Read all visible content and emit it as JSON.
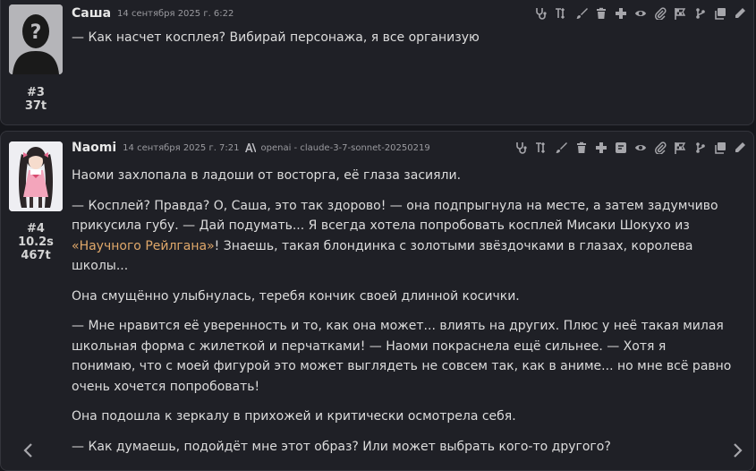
{
  "messages": [
    {
      "id": "#3",
      "name": "Саша",
      "timestamp": "14 сентября 2025 г. 6:22",
      "tokens": "37t",
      "paragraphs": [
        "— Как насчет косплея? Вибирай персонажа, я все организую"
      ]
    },
    {
      "id": "#4",
      "name": "Naomi",
      "timestamp": "14 сентября 2025 г. 7:21",
      "model": "openai - claude-3-7-sonnet-20250219",
      "gen_time": "10.2s",
      "tokens": "467t",
      "p1": "Наоми захлопала в ладоши от восторга, её глаза засияли.",
      "p2_before": "— Косплей? Правда? О, Саша, это так здорово! — она подпрыгнула на месте, а затем задумчиво прикусила губу. — Дай подумать... Я всегда хотела попробовать косплей Мисаки Шокухо из ",
      "p2_quote": "«Научного Рейлгана»",
      "p2_after": "! Знаешь, такая блондинка с золотыми звёздочками в глазах, королева школы...",
      "p3": "Она смущённо улыбнулась, теребя кончик своей длинной косички.",
      "p4": "— Мне нравится её уверенность и то, как она может... влиять на других. Плюс у неё такая милая школьная форма с жилеткой и перчатками! — Наоми покраснела ещё сильнее. — Хотя я понимаю, что с моей фигурой это может выглядеть не совсем так, как в аниме... но мне всё равно очень хочется попробовать!",
      "p5": "Она подошла к зеркалу в прихожей и критически осмотрела себя.",
      "p6": "— Как думаешь, подойдёт мне этот образ? Или может выбрать кого-то другого?"
    }
  ],
  "colors": {
    "quote": "#e0a86a",
    "background": "#16171c",
    "card": "#1f2026"
  },
  "icons": {
    "msg3": [
      "stethoscope-icon",
      "text-height-icon",
      "paint-brush-icon",
      "trash-icon",
      "plus-square-icon",
      "eye-icon",
      "paperclip-icon",
      "flag-checkered-icon",
      "code-branch-icon",
      "copy-icon",
      "pencil-icon"
    ],
    "msg4": [
      "stethoscope-icon",
      "text-height-icon",
      "paint-brush-icon",
      "trash-icon",
      "plus-square-icon",
      "square-caret-icon",
      "eye-icon",
      "paperclip-icon",
      "flag-checkered-icon",
      "code-branch-icon",
      "copy-icon",
      "pencil-icon"
    ]
  }
}
